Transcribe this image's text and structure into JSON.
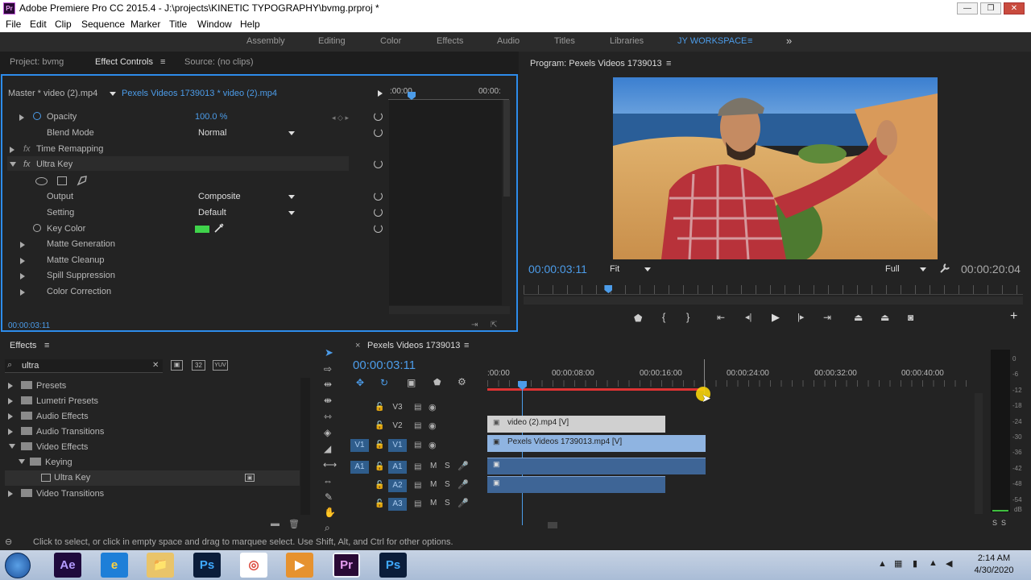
{
  "window": {
    "title": "Adobe Premiere Pro CC 2015.4 - J:\\projects\\KINETIC TYPOGRAPHY\\bvmg.prproj *",
    "app_badge": "Pr",
    "minimize": "—",
    "maximize": "❐",
    "close": "✕"
  },
  "menu": [
    "File",
    "Edit",
    "Clip",
    "Sequence",
    "Marker",
    "Title",
    "Window",
    "Help"
  ],
  "workspaces": [
    "Assembly",
    "Editing",
    "Color",
    "Effects",
    "Audio",
    "Titles",
    "Libraries",
    "JY WORKSPACE"
  ],
  "workspace_menu": "≡",
  "workspace_more": "»",
  "effect_panel": {
    "tabs": [
      "Project: bvmg",
      "Effect Controls",
      "Source: (no clips)"
    ],
    "menu_icon": "≡",
    "master": "Master * video (2).mp4",
    "clip": "Pexels Videos 1739013 * video (2).mp4",
    "tc_left": ":00:00",
    "tc_right": "00:00:",
    "opacity_label": "Opacity",
    "opacity_value": "100.0 %",
    "blend_label": "Blend Mode",
    "blend_value": "Normal",
    "time_remap": "Time Remapping",
    "fx": "fx",
    "ultra_key": "Ultra Key",
    "output_label": "Output",
    "output_value": "Composite",
    "setting_label": "Setting",
    "setting_value": "Default",
    "key_color_label": "Key Color",
    "key_color": "#3fd34b",
    "matte_gen": "Matte Generation",
    "matte_clean": "Matte Cleanup",
    "spill": "Spill Suppression",
    "color_corr": "Color Correction",
    "timecode": "00:00:03:11"
  },
  "program": {
    "title": "Program: Pexels Videos 1739013",
    "menu_icon": "≡",
    "timecode": "00:00:03:11",
    "fit": "Fit",
    "full": "Full",
    "duration": "00:00:20:04",
    "playhead_fraction": 0.17,
    "add_button": "+"
  },
  "effects_panel": {
    "title": "Effects",
    "menu_icon": "≡",
    "search": "ultra",
    "clear": "✕",
    "badges": [
      "32",
      "YUV"
    ],
    "items": [
      {
        "label": "Presets"
      },
      {
        "label": "Lumetri Presets"
      },
      {
        "label": "Audio Effects"
      },
      {
        "label": "Audio Transitions"
      },
      {
        "label": "Video Effects"
      },
      {
        "label": "Keying"
      },
      {
        "label": "Ultra Key"
      },
      {
        "label": "Video Transitions"
      }
    ]
  },
  "timeline": {
    "close": "×",
    "title": "Pexels Videos 1739013",
    "menu_icon": "≡",
    "timecode": "00:00:03:11",
    "ruler": [
      ":00:00",
      "00:00:08:00",
      "00:00:16:00",
      "00:00:24:00",
      "00:00:32:00",
      "00:00:40:00"
    ],
    "tracks": [
      {
        "src": "",
        "name": "V3",
        "clip": ""
      },
      {
        "src": "",
        "name": "V2",
        "clip": "video (2).mp4 [V]"
      },
      {
        "src": "V1",
        "name": "V1",
        "clip": "Pexels Videos 1739013.mp4 [V]"
      },
      {
        "src": "A1",
        "name": "A1",
        "clip": ""
      },
      {
        "src": "",
        "name": "A2",
        "clip": ""
      },
      {
        "src": "",
        "name": "A3",
        "clip": ""
      }
    ],
    "m": "M",
    "s": "S"
  },
  "meter": {
    "ticks": [
      "0",
      "-6",
      "-12",
      "-18",
      "-24",
      "-30",
      "-36",
      "-42",
      "-48",
      "-54",
      "dB"
    ],
    "solo": [
      "S",
      "S"
    ]
  },
  "status": "Click to select, or click in empty space and drag to marquee select. Use Shift, Alt, and Ctrl for other options.",
  "taskbar": {
    "apps": [
      {
        "name": "Ae",
        "color": "#1f0a3d",
        "fg": "#b49cff"
      },
      {
        "name": "e",
        "color": "#1e7fd8",
        "fg": "#ffd23f"
      },
      {
        "name": "📁",
        "color": "#e9c46a",
        "fg": "#7a5a12"
      },
      {
        "name": "Ps",
        "color": "#0b1d3a",
        "fg": "#3fa9ff"
      },
      {
        "name": "◎",
        "color": "#ffffff",
        "fg": "#db4437"
      },
      {
        "name": "▶",
        "color": "#e6922f",
        "fg": "#ffffff"
      },
      {
        "name": "Pr",
        "color": "#2a0a36",
        "fg": "#e59cf0"
      },
      {
        "name": "Ps",
        "color": "#0b1d3a",
        "fg": "#3fa9ff"
      }
    ],
    "time": "2:14 AM",
    "date": "4/30/2020"
  }
}
